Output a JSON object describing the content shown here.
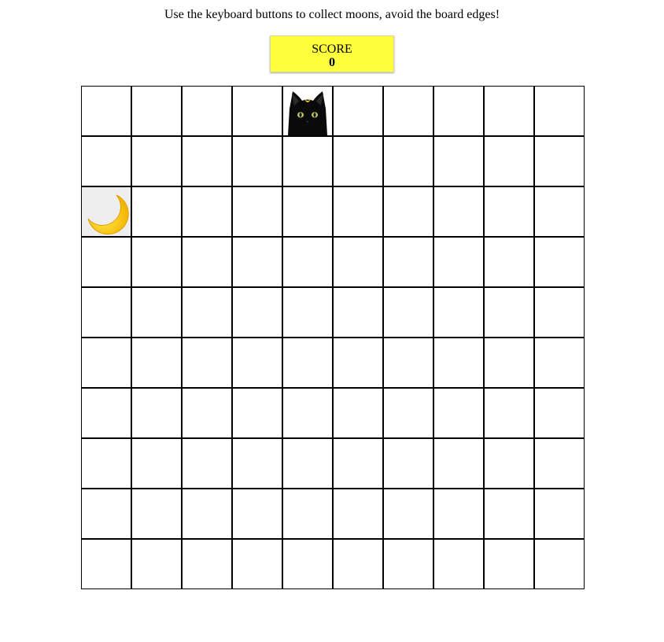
{
  "instructions": "Use the keyboard buttons to collect moons, avoid the board edges!",
  "score": {
    "label": "SCORE",
    "value": "0"
  },
  "board": {
    "rows": 10,
    "cols": 10,
    "cat": {
      "row": 0,
      "col": 4,
      "icon": "black-cat-icon"
    },
    "moon": {
      "row": 2,
      "col": 0,
      "icon": "crescent-moon-icon"
    }
  },
  "colors": {
    "score_background": "#ffff3c",
    "grid_line": "#000000",
    "moon_yellow": "#ffd21f"
  }
}
